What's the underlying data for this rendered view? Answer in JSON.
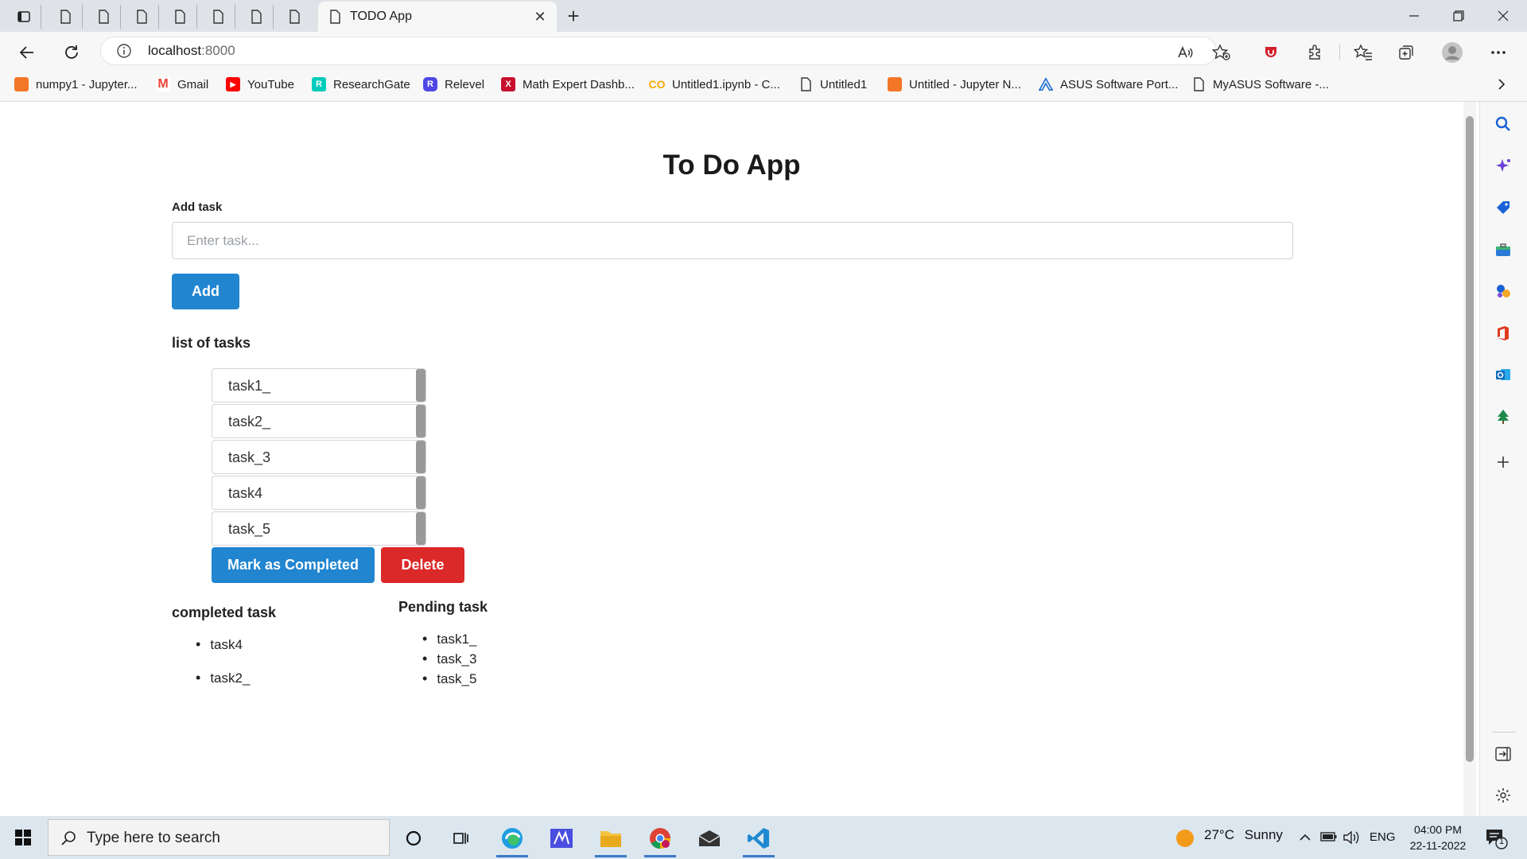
{
  "browser": {
    "tab_title": "TODO App",
    "new_tab_symbol": "+",
    "url_host": "localhost",
    "url_port": ":8000"
  },
  "bookmarks": [
    {
      "label": "numpy1 - Jupyter...",
      "icon": "jupyter-icon",
      "color": "#f37726"
    },
    {
      "label": "Gmail",
      "icon": "gmail-icon",
      "color": "#ea4335"
    },
    {
      "label": "YouTube",
      "icon": "youtube-icon",
      "color": "#ff0000"
    },
    {
      "label": "ResearchGate",
      "icon": "researchgate-icon",
      "color": "#00ccbb"
    },
    {
      "label": "Relevel",
      "icon": "relevel-icon",
      "color": "#4f46e5"
    },
    {
      "label": "Math Expert Dashb...",
      "icon": "math-expert-icon",
      "color": "#c8102e"
    },
    {
      "label": "Untitled1.ipynb - C...",
      "icon": "colab-icon",
      "color": "#f9ab00"
    },
    {
      "label": "Untitled1",
      "icon": "page-icon",
      "color": "#333333"
    },
    {
      "label": "Untitled - Jupyter N...",
      "icon": "jupyter-icon",
      "color": "#f37726"
    },
    {
      "label": "ASUS Software Port...",
      "icon": "asus-icon",
      "color": "#1f6fd6"
    },
    {
      "label": "MyASUS Software -...",
      "icon": "page-icon",
      "color": "#333333"
    }
  ],
  "app": {
    "title": "To Do App",
    "add_label": "Add task",
    "input_placeholder": "Enter task...",
    "input_value": "",
    "add_button": "Add",
    "list_heading": "list of tasks",
    "tasks": [
      "task1_",
      "task2_",
      "task_3",
      "task4",
      "task_5"
    ],
    "mark_button": "Mark as Completed",
    "delete_button": "Delete",
    "completed_heading": "completed task",
    "completed": [
      "task4",
      "task2_"
    ],
    "pending_heading": "Pending task",
    "pending": [
      "task1_",
      "task_3",
      "task_5"
    ],
    "colors": {
      "primary": "#2185d0",
      "danger": "#db2828"
    }
  },
  "taskbar": {
    "search_placeholder": "Type here to search",
    "weather_temp": "27°C",
    "weather_text": "Sunny",
    "language": "ENG",
    "time": "04:00 PM",
    "date": "22-11-2022",
    "notification_count": "1"
  }
}
